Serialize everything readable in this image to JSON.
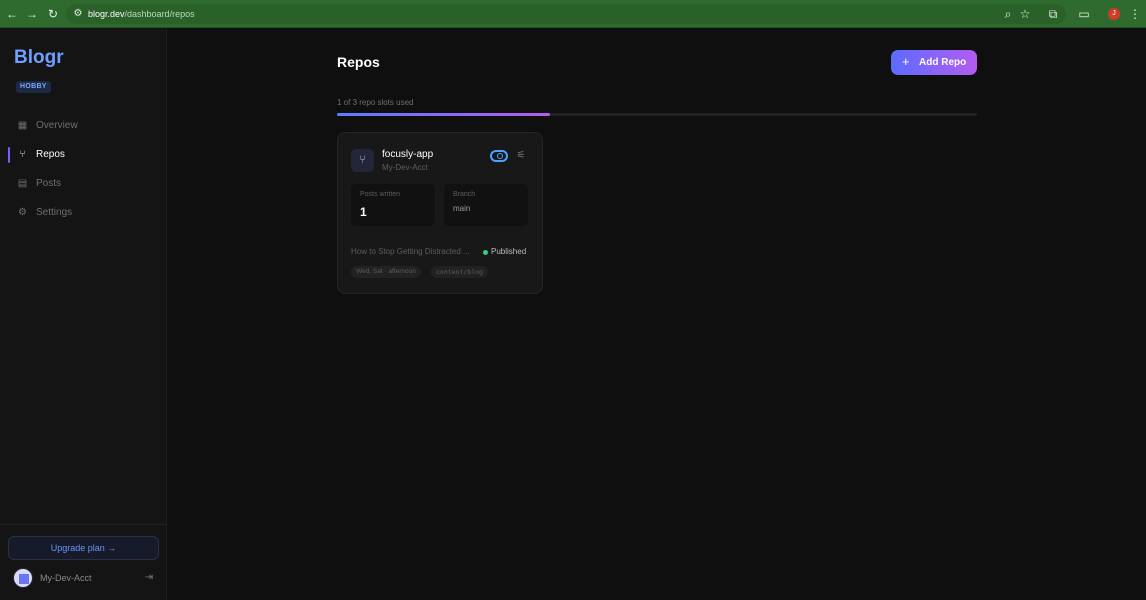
{
  "browser": {
    "url_host": "blogr.dev",
    "url_path": "/dashboard/repos",
    "profile_initial": "J"
  },
  "sidebar": {
    "logo": "Blogr",
    "plan_badge": "HOBBY",
    "items": [
      {
        "label": "Overview",
        "icon": "grid-icon",
        "active": false
      },
      {
        "label": "Repos",
        "icon": "git-branch-icon",
        "active": true
      },
      {
        "label": "Posts",
        "icon": "document-icon",
        "active": false
      },
      {
        "label": "Settings",
        "icon": "gear-icon",
        "active": false
      }
    ],
    "upgrade_label": "Upgrade plan →",
    "user_name": "My-Dev-Acct"
  },
  "main": {
    "title": "Repos",
    "add_button_label": "Add Repo",
    "slots_text": "1 of 3 repo slots used",
    "slots_used_fraction": 0.333,
    "accent_color": "#5b6cff",
    "repos": [
      {
        "name": "focusly-app",
        "owner": "My-Dev-Acct",
        "enabled": true,
        "stats": {
          "posts_label": "Posts written",
          "posts_value": "1",
          "branch_label": "Branch",
          "branch_value": "main"
        },
        "latest_post": "How to Stop Getting Distracted ...",
        "status": "Published",
        "status_color": "#2ed47a",
        "tags": [
          "Wed, Sat · afternoon",
          "content/blog"
        ]
      }
    ]
  }
}
